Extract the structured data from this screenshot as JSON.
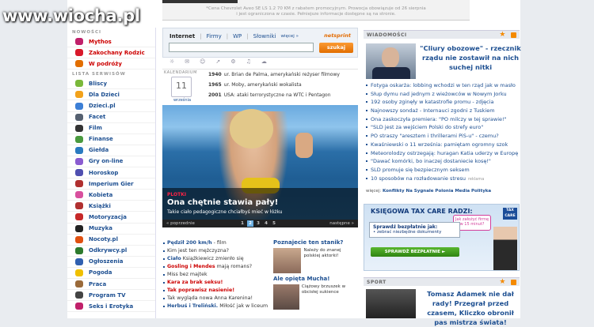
{
  "watermark": "www.wiocha.pl",
  "banner": {
    "line1": "*Cena Chevrolet Aveo SE LS 1.2 70 KM z rabatem promocyjnym. Prowocja obowiązuje od 26 sierpnia",
    "line2": "i jest ograniczona w czasie. Pełniejsze informacje dostępne są na stronie."
  },
  "sidebar": {
    "section_new": "NOWOŚCI",
    "new_items": [
      {
        "label": "Mythos",
        "color": "#c0206a"
      },
      {
        "label": "Zakochany Rodzic",
        "color": "#d8182a"
      },
      {
        "label": "W podróży",
        "color": "#e26e00"
      }
    ],
    "section_list": "LISTA SERWISÓW",
    "services": [
      {
        "label": "Bliscy",
        "color": "#7ab83a"
      },
      {
        "label": "Dla Dzieci",
        "color": "#f2a21b"
      },
      {
        "label": "Dzieci.pl",
        "color": "#3c7fd6"
      },
      {
        "label": "Facet",
        "color": "#556070"
      },
      {
        "label": "Film",
        "color": "#333"
      },
      {
        "label": "Finanse",
        "color": "#4a9a3e"
      },
      {
        "label": "Giełda",
        "color": "#2a7ac0"
      },
      {
        "label": "Gry on-line",
        "color": "#8a5bd0"
      },
      {
        "label": "Horoskop",
        "color": "#4f4fb0"
      },
      {
        "label": "Imperium Gier",
        "color": "#b03030"
      },
      {
        "label": "Kobieta",
        "color": "#d8509e"
      },
      {
        "label": "Książki",
        "color": "#b03030"
      },
      {
        "label": "Motoryzacja",
        "color": "#c62828"
      },
      {
        "label": "Muzyka",
        "color": "#222"
      },
      {
        "label": "Nocoty.pl",
        "color": "#e05010"
      },
      {
        "label": "Odkrywcy.pl",
        "color": "#2d7a2d"
      },
      {
        "label": "Ogłoszenia",
        "color": "#3060b0"
      },
      {
        "label": "Pogoda",
        "color": "#f0c000"
      },
      {
        "label": "Praca",
        "color": "#9a6a3a"
      },
      {
        "label": "Program TV",
        "color": "#444"
      },
      {
        "label": "Seks i Erotyka",
        "color": "#c0206a"
      }
    ]
  },
  "search": {
    "tabs": [
      "Internet",
      "Firmy",
      "WP",
      "Słowniki",
      "więcej »"
    ],
    "brand": "netsprint",
    "button": "szukaj",
    "value": ""
  },
  "toolbar": {
    "icons": [
      "☼",
      "✉",
      "☺",
      "➚",
      "⚙",
      "♫",
      "☁"
    ]
  },
  "calendar": {
    "label": "KALENDARIUM",
    "day": "11",
    "month": "września",
    "events": [
      {
        "year": "1940",
        "text": "ur. Brian de Palma, amerykański reżyser filmowy"
      },
      {
        "year": "1965",
        "text": "ur. Moby, amerykański wokalista"
      },
      {
        "year": "2001",
        "text": "USA: ataki terrorystyczne na WTC i Pentagon"
      }
    ]
  },
  "hero": {
    "kicker": "PLOTKI",
    "title": "Ona chętnie stawia pały!",
    "sub": "Takie ciało pedagogiczne chciałbyś mieć w łóżku",
    "prev": "« poprzednie",
    "next": "następne »",
    "pages": [
      "1",
      "2",
      "3",
      "4",
      "5"
    ],
    "active": 1
  },
  "news": [
    {
      "bold": "Pędził 200 km/h",
      "rest": " - film",
      "boldRed": false
    },
    {
      "bold": "",
      "rest": "Kim jest ten mężczyzna?",
      "boldRed": false
    },
    {
      "bold": "Ciało",
      "rest": " Książkiewicz zmienło się",
      "boldRed": false
    },
    {
      "bold": "Gosling i Mendes",
      "rest": " mają romans?",
      "boldRed": true
    },
    {
      "bold": "",
      "rest": "Miss bez majtek",
      "boldRed": false
    },
    {
      "bold": "Kara za brak seksu!",
      "rest": "",
      "boldRed": true
    },
    {
      "bold": "Tak poprawisz nasienie!",
      "rest": "",
      "boldRed": true
    },
    {
      "bold": "",
      "rest": "Tak wygląda nowa Anna Karenina!",
      "boldRed": false
    },
    {
      "bold": "Herbuś i Treliński.",
      "rest": " Miłość jak w liceum",
      "boldRed": false
    }
  ],
  "poznajecie": {
    "h1": "Poznajecie ten stanik?",
    "t1": "Należy do znanej polskiej aktorki!",
    "h2": "Ale opięta Mucha!",
    "t2": "Ciążowy brzuszek w obcisłej sukience"
  },
  "right": {
    "wiadomosci": "WIADOMOŚCI",
    "headline": "\"Cliury obozowe\" - rzecznik rządu nie zostawił na nich suchej nitki",
    "items": [
      {
        "text": "Fotyga oskarża: lobbing wchodzi w ten rząd jak w masło",
        "tag": ""
      },
      {
        "text": "Słup dymu nad jednym z wieżowców w Nowym Jorku",
        "tag": ""
      },
      {
        "text": "192 osoby zginęły w katastrofie promu - zdjęcia",
        "tag": ""
      },
      {
        "text": "Najnowszy sondaż - Internauci zgodni z Tuskiem",
        "tag": ""
      },
      {
        "text": "Ona zaskoczyła premiera: \"PO milczy w tej sprawie!\"",
        "tag": ""
      },
      {
        "text": "\"SLD jest za wejściem Polski do strefy euro\"",
        "tag": ""
      },
      {
        "text": "PO straszy \"aresztem i thrillerami PiS-u\" - czemu?",
        "tag": ""
      },
      {
        "text": "Kwaśniewski o 11 września: pamiętam ogromny szok",
        "tag": ""
      },
      {
        "text": "Meteorolodzy ostrzegają: huragan Katia uderzy w Europę",
        "tag": ""
      },
      {
        "text": "\"Dawać komórki, bo inaczej dostaniecie kosę!\"",
        "tag": ""
      },
      {
        "text": "SLD promuje się bezpiecznym seksem",
        "tag": ""
      },
      {
        "text": "10 sposobów na rozładowanie stresu",
        "tag": "reklama"
      }
    ],
    "more_label": "więcej:",
    "more_links": "Konflikty Na Sygnale Polonia Media Polityka",
    "ad": {
      "title": "KSIĘGOWA TAX CARE RADZI:",
      "bubble": "Jak założyć firmę w 15 minut?",
      "box_title": "Sprawdź bezpłatnie jak:",
      "box_item": "• zebrać niezbędne dokumenty",
      "button": "SPRAWDŹ BEZPŁATNIE ►",
      "logo": "TAX CARE"
    },
    "sport": "SPORT",
    "sport_headline": "Tomasz Adamek nie dał rady! Przegrał przed czasem, Kliczko obronił pas mistrza świata!"
  }
}
